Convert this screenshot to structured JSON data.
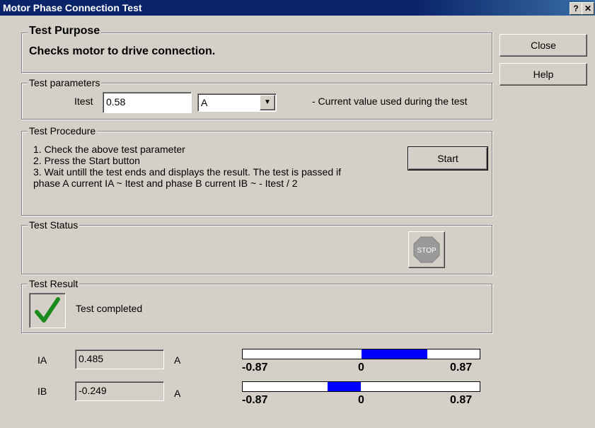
{
  "window": {
    "title": "Motor Phase Connection Test",
    "help_glyph": "?",
    "close_glyph": "✕"
  },
  "buttons": {
    "close": "Close",
    "help": "Help",
    "start": "Start"
  },
  "purpose": {
    "legend": "Test Purpose",
    "text": "Checks motor to drive connection."
  },
  "parameters": {
    "legend": "Test parameters",
    "itest_label": "Itest",
    "itest_value": "0.58",
    "unit_selected": "A",
    "description": "- Current value used during the test"
  },
  "procedure": {
    "legend": "Test Procedure",
    "steps": [
      "1. Check the above test parameter",
      "2. Press the Start button",
      "3. Wait untill the test ends and displays the result. The test is passed if",
      "phase A current IA ~ Itest and phase B current IB ~ - Itest / 2"
    ]
  },
  "status": {
    "legend": "Test Status",
    "stop_label": "STOP"
  },
  "result": {
    "legend": "Test Result",
    "text": "Test completed"
  },
  "readouts": [
    {
      "label": "IA",
      "value": "0.485",
      "unit": "A",
      "scale_min": "-0.87",
      "scale_mid": "0",
      "scale_max": "0.87",
      "fill_value": 0.485
    },
    {
      "label": "IB",
      "value": "-0.249",
      "unit": "A",
      "scale_min": "-0.87",
      "scale_mid": "0",
      "scale_max": "0.87",
      "fill_value": -0.249
    }
  ],
  "colors": {
    "bar_fill": "#0000ff",
    "check": "#1a8a1a",
    "title_bg": "#0a246a"
  }
}
